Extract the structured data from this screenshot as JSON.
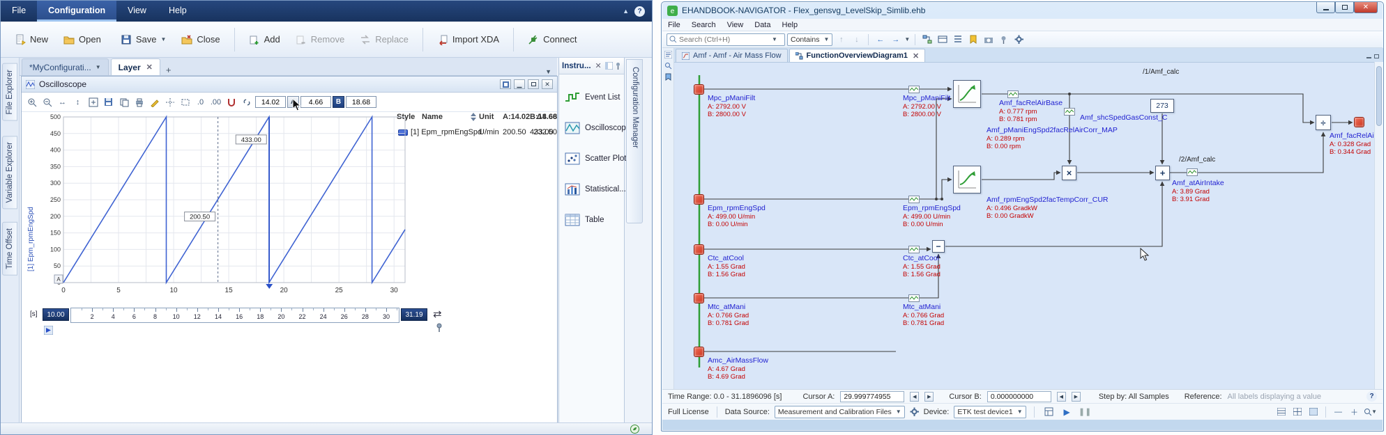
{
  "left_app": {
    "menu": {
      "file": "File",
      "configuration": "Configuration",
      "view": "View",
      "help": "Help"
    },
    "toolbar": {
      "new": "New",
      "open": "Open",
      "save": "Save",
      "close": "Close",
      "add": "Add",
      "remove": "Remove",
      "replace": "Replace",
      "import_xda": "Import XDA",
      "connect": "Connect"
    },
    "side_tabs": {
      "file_explorer": "File Explorer",
      "variable_explorer": "Variable Explorer",
      "time_offset": "Time Offset"
    },
    "doc_tabs": {
      "config": "*MyConfigurati...",
      "layer": "Layer"
    },
    "right_tab": "Configuration Manager",
    "instruments": {
      "tab": "Instru...",
      "event_list": "Event List",
      "oscilloscope": "Oscilloscope",
      "scatter_plot": "Scatter Plot",
      "statistical": "Statistical...",
      "table": "Table"
    },
    "osc": {
      "title": "Oscilloscope",
      "precision0": ".0",
      "precision00": ".00",
      "cursor_a": "14.02",
      "badge_a": "A",
      "delta": "4.66",
      "badge_b": "B",
      "cursor_b": "18.68"
    },
    "table": {
      "h_style": "Style",
      "h_name": "Name",
      "h_unit": "Unit",
      "h_a": "A:14.02",
      "h_b": "B:18.68",
      "h_delta": "Δ4.66",
      "row_name": "[1] Epm_rpmEngSpd",
      "row_unit": "U/min",
      "row_a": "200.50",
      "row_b": "433.00",
      "row_delta": "232.50"
    },
    "slider": {
      "unit": "[s]",
      "start": "10.00",
      "end": "31.19"
    }
  },
  "chart_data": {
    "type": "line",
    "title": "Oscilloscope",
    "ylabel": "[1] Epm_rpmEngSpd",
    "xlabel": "[s]",
    "xlim": [
      0,
      31
    ],
    "ylim": [
      0,
      500
    ],
    "x_ticks": [
      0,
      5,
      10,
      15,
      20,
      25,
      30
    ],
    "y_ticks": [
      0,
      50,
      100,
      150,
      200,
      250,
      300,
      350,
      400,
      450,
      500
    ],
    "slider_ticks": [
      2,
      4,
      6,
      8,
      10,
      12,
      14,
      16,
      18,
      20,
      22,
      24,
      26,
      28,
      30
    ],
    "slider_range": [
      0,
      31.19
    ],
    "grid": true,
    "series": [
      {
        "name": "[1] Epm_rpmEngSpd",
        "unit": "U/min",
        "color": "#3f63d2",
        "points": [
          [
            0,
            0
          ],
          [
            9.33,
            500
          ],
          [
            9.33,
            0
          ],
          [
            18.66,
            500
          ],
          [
            18.66,
            0
          ],
          [
            28,
            500
          ],
          [
            28,
            0
          ],
          [
            31,
            160
          ]
        ]
      }
    ],
    "cursors": {
      "a_x": 14.02,
      "a_value": 200.5,
      "b_x": 18.68,
      "b_value": 433.0,
      "delta_x": 4.66,
      "corner_label": "A"
    }
  },
  "right_app": {
    "title": "EHANDBOOK-NAVIGATOR - Flex_gensvg_LevelSkip_Simlib.ehb",
    "menu": {
      "file": "File",
      "search": "Search",
      "view": "View",
      "data": "Data",
      "help": "Help"
    },
    "search_placeholder": "Search (Ctrl+H)",
    "contains": "Contains",
    "tabs": {
      "tab1": "Amf - Amf - Air Mass Flow",
      "tab2": "FunctionOverviewDiagram1"
    },
    "diagram": {
      "calc1": "/1/Amf_calc",
      "calc2": "/2/Amf_calc",
      "const273": "273",
      "op_mul": "×",
      "op_add": "+",
      "op_sub": "−",
      "op_div": "÷",
      "mpc": {
        "name": "Mpc_pManiFilt",
        "a": "A: 2792.00 V",
        "b": "B: 2800.00 V"
      },
      "epm": {
        "name": "Epm_rpmEngSpd",
        "a": "A: 499.00 U/min",
        "b": "B: 0.00 U/min"
      },
      "ctc": {
        "name": "Ctc_atCool",
        "a": "A: 1.55 Grad",
        "b": "B: 1.56 Grad"
      },
      "mtc": {
        "name": "Mtc_atMani",
        "a": "A: 0.766 Grad",
        "b": "B: 0.781 Grad"
      },
      "amc": {
        "name": "Amc_AirMassFlow",
        "a": "A: 4.67 Grad",
        "b": "B: 4.69 Grad"
      },
      "map": {
        "name": "Amf_pManiEngSpd2facRelAirCorr_MAP",
        "a": "A: 0.289 rpm",
        "b": "B: 0.00 rpm"
      },
      "cur": {
        "name": "Amf_rpmEngSpd2facTempCorr_CUR",
        "a": "A: 0.496 GradkW",
        "b": "B: 0.00 GradkW"
      },
      "base": {
        "name": "Amf_facRelAirBase",
        "a": "A: 0.777 rpm",
        "b": "B: 0.781 rpm"
      },
      "shc": {
        "name": "Amf_shcSpedGasConst_C"
      },
      "intake": {
        "name": "Amf_atAirIntake",
        "a": "A: 3.89 Grad",
        "b": "B: 3.91 Grad"
      },
      "out": {
        "name": "Amf_facRelAir",
        "a": "A: 0.328 Grad",
        "b": "B: 0.344 Grad"
      }
    },
    "status": {
      "time_range": "Time Range: 0.0 - 31.1896096 [s]",
      "cursor_a_label": "Cursor A:",
      "cursor_a_value": "29.999774955",
      "cursor_b_label": "Cursor B:",
      "cursor_b_value": "0.000000000",
      "step_by": "Step by: All Samples",
      "reference_label": "Reference:",
      "reference_value": "All labels displaying a value"
    },
    "bottom": {
      "license": "Full License",
      "data_source_label": "Data Source:",
      "data_source": "Measurement and Calibration Files",
      "device_label": "Device:",
      "device": "ETK test device1"
    }
  }
}
